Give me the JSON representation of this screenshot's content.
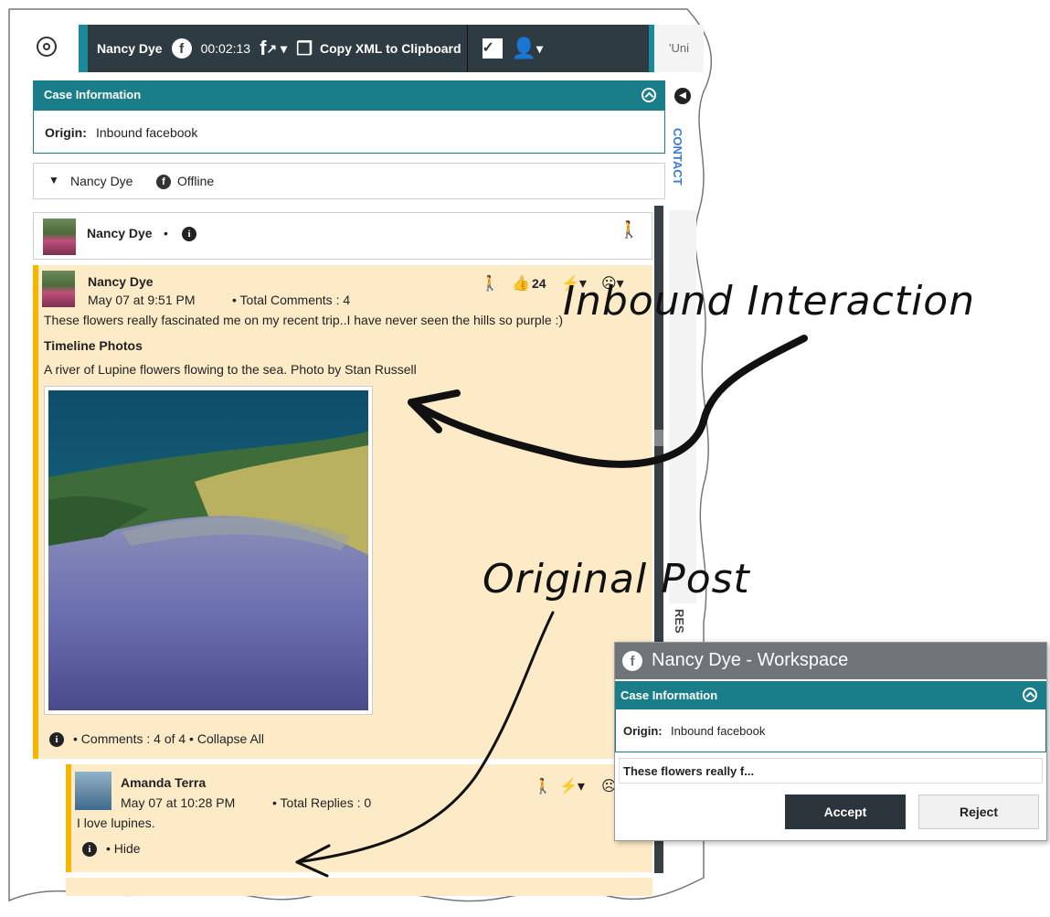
{
  "toolbar": {
    "contact_name": "Nancy Dye",
    "timer": "00:02:13",
    "copy_xml_label": "Copy XML to Clipboard",
    "next_tab_label": "'Uni"
  },
  "case_info": {
    "title": "Case Information",
    "origin_label": "Origin:",
    "origin_value": "Inbound facebook"
  },
  "contact_bar": {
    "name": "Nancy Dye",
    "status": "Offline"
  },
  "side_tabs": {
    "contact": "CONTACT",
    "responses": "RES"
  },
  "header_row": {
    "name": "Nancy Dye",
    "separator": "•"
  },
  "post": {
    "author": "Nancy Dye",
    "date": "May 07 at 9:51 PM",
    "total_comments": "• Total Comments : 4",
    "likes": "24",
    "text": "These flowers really fascinated me on my recent trip..I have never seen the hills so purple :)",
    "section_title": "Timeline Photos",
    "caption": "A river of Lupine flowers flowing to the sea. Photo by Stan Russell",
    "footer": "• Comments : 4 of 4 • Collapse All"
  },
  "comment": {
    "author": "Amanda Terra",
    "date": "May 07 at 10:28 PM",
    "total_replies": "• Total Replies : 0",
    "text": "I love lupines.",
    "footer": "• Hide"
  },
  "annotations": {
    "inbound": "Inbound Interaction",
    "original": "Original Post"
  },
  "workspace": {
    "title": "Nancy Dye - Workspace",
    "case_title": "Case Information",
    "origin_label": "Origin:",
    "origin_value": "Inbound facebook",
    "preview": "These flowers really f...",
    "accept_label": "Accept",
    "reject_label": "Reject"
  }
}
